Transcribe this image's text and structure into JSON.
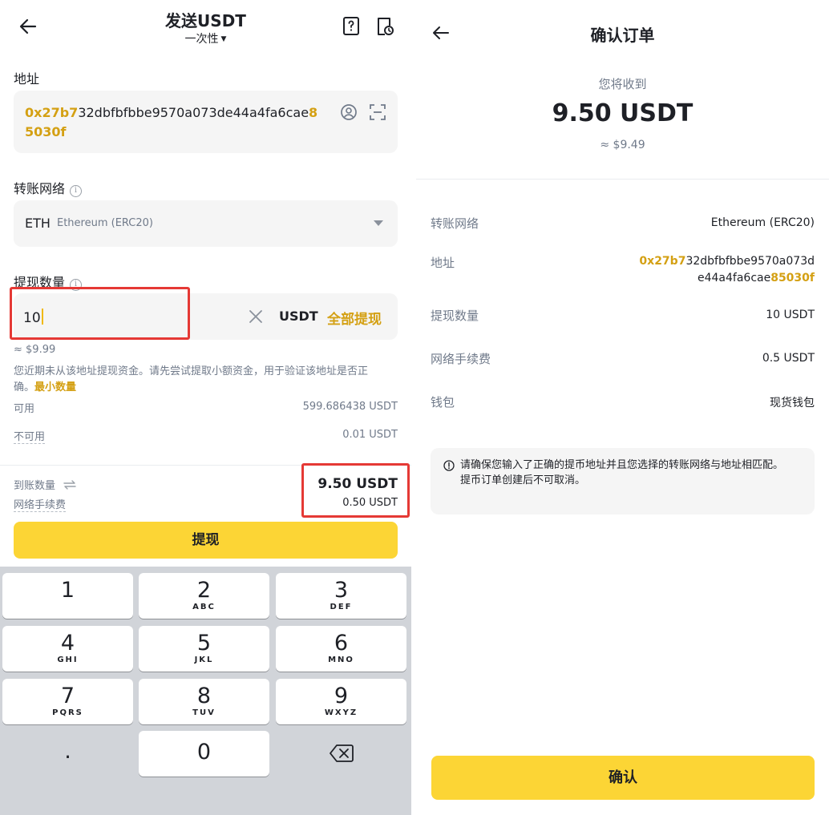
{
  "send": {
    "title": "发送USDT",
    "mode": "一次性",
    "address_label": "地址",
    "address_prefix": "0x27b7",
    "address_middle": "32dbfbfbbe9570a073de44a4fa6cae",
    "address_suffix": "85030f",
    "network_label": "转账网络",
    "network_symbol": "ETH",
    "network_name": "Ethereum (ERC20)",
    "amount_label": "提现数量",
    "amount_value": "10",
    "amount_unit": "USDT",
    "withdraw_all": "全部提现",
    "amount_usd": "≈ $9.99",
    "warning_text": "您近期未从该地址提现资金。请先尝试提取小额资金，用于验证该地址是否正确。",
    "warning_link": "最小数量",
    "available_label": "可用",
    "available_value": "599.686438 USDT",
    "unavailable_label": "不可用",
    "unavailable_value": "0.01 USDT",
    "receive_label": "到账数量",
    "fee_label": "网络手续费",
    "receive_value": "9.50 USDT",
    "fee_value": "0.50 USDT",
    "withdraw_button": "提现"
  },
  "keypad": [
    {
      "digit": "1",
      "letters": ""
    },
    {
      "digit": "2",
      "letters": "ABC"
    },
    {
      "digit": "3",
      "letters": "DEF"
    },
    {
      "digit": "4",
      "letters": "GHI"
    },
    {
      "digit": "5",
      "letters": "JKL"
    },
    {
      "digit": "6",
      "letters": "MNO"
    },
    {
      "digit": "7",
      "letters": "PQRS"
    },
    {
      "digit": "8",
      "letters": "TUV"
    },
    {
      "digit": "9",
      "letters": "WXYZ"
    },
    {
      "digit": ".",
      "letters": ""
    },
    {
      "digit": "0",
      "letters": ""
    }
  ],
  "confirm": {
    "title": "确认订单",
    "receive_label": "您将收到",
    "receive_amount": "9.50 USDT",
    "receive_usd": "≈ $9.49",
    "network_label": "转账网络",
    "network_value": "Ethereum (ERC20)",
    "address_label": "地址",
    "address_prefix": "0x27b7",
    "address_middle": "32dbfbfbbe9570a073de44a4fa6cae",
    "address_suffix": "85030f",
    "amount_label": "提现数量",
    "amount_value": "10 USDT",
    "fee_label": "网络手续费",
    "fee_value": "0.5 USDT",
    "wallet_label": "钱包",
    "wallet_value": "现货钱包",
    "notice_line1": "请确保您输入了正确的提币地址并且您选择的转账网络与地址相匹配。",
    "notice_line2": "提币订单创建后不可取消。",
    "confirm_button": "确认"
  },
  "colors": {
    "accent": "#fcd535",
    "highlight": "#d4a013",
    "annotation": "#e53935"
  }
}
